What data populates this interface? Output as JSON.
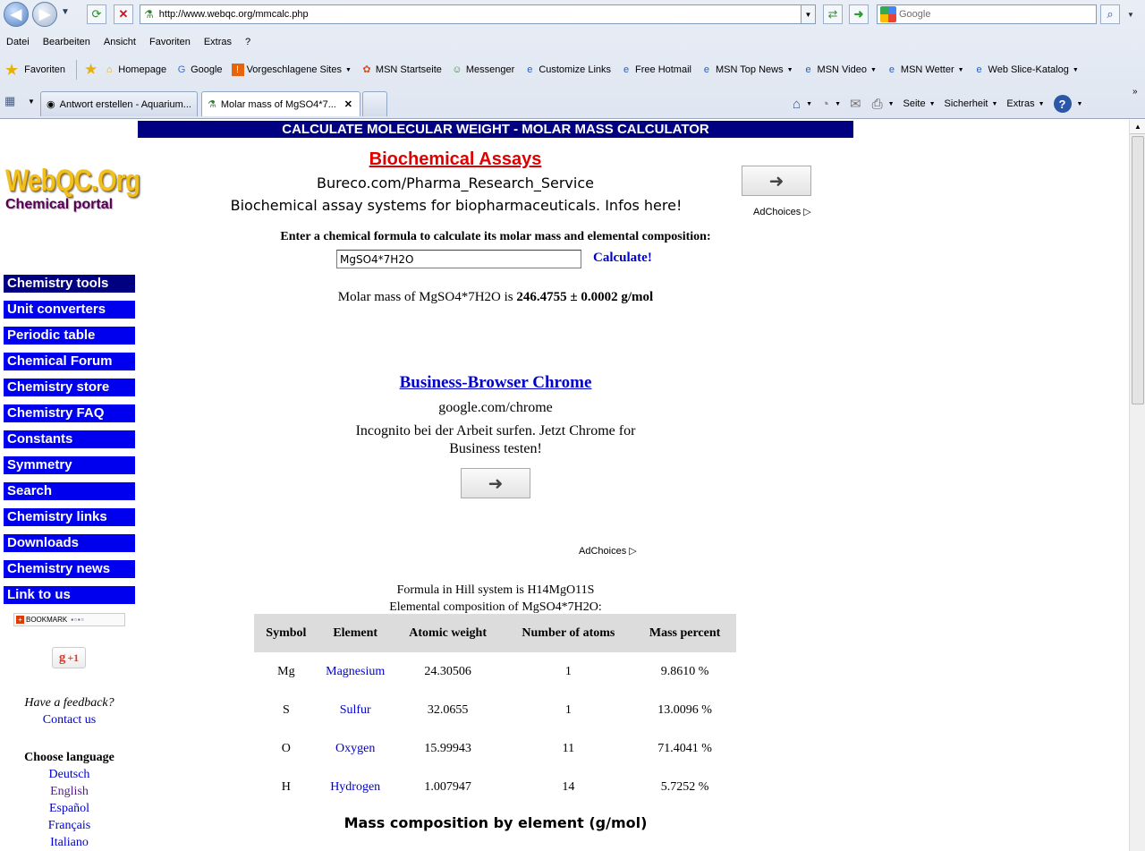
{
  "browser": {
    "address": "http://www.webqc.org/mmcalc.php",
    "search_placeholder": "Google",
    "menu": [
      "Datei",
      "Bearbeiten",
      "Ansicht",
      "Favoriten",
      "Extras",
      "?"
    ],
    "favorites_label": "Favoriten",
    "favorites": [
      {
        "label": "Homepage",
        "icon": "home-icon"
      },
      {
        "label": "Google",
        "icon": "google-icon"
      },
      {
        "label": "Vorgeschlagene Sites",
        "icon": "suggested-sites-icon",
        "dropdown": true
      },
      {
        "label": "MSN Startseite",
        "icon": "msn-icon"
      },
      {
        "label": "Messenger",
        "icon": "messenger-icon"
      },
      {
        "label": "Customize Links",
        "icon": "ie-icon"
      },
      {
        "label": "Free Hotmail",
        "icon": "ie-icon"
      },
      {
        "label": "MSN Top News",
        "icon": "ie-icon",
        "dropdown": true
      },
      {
        "label": "MSN Video",
        "icon": "ie-icon",
        "dropdown": true
      },
      {
        "label": "MSN Wetter",
        "icon": "ie-icon",
        "dropdown": true
      },
      {
        "label": "Web Slice-Katalog",
        "icon": "ie-icon",
        "dropdown": true
      }
    ],
    "tabs": [
      {
        "label": "Antwort erstellen - Aquarium...",
        "active": false
      },
      {
        "label": "Molar mass of MgSO4*7...",
        "active": true
      }
    ],
    "commands": [
      "Seite",
      "Sicherheit",
      "Extras"
    ]
  },
  "page": {
    "banner": "CALCULATE MOLECULAR WEIGHT - MOLAR MASS CALCULATOR",
    "logo": {
      "main": "WebQC.Org",
      "sub": "Chemical portal"
    },
    "nav": [
      "Chemistry tools",
      "Unit converters",
      "Periodic table",
      "Chemical Forum",
      "Chemistry store",
      "Chemistry FAQ",
      "Constants",
      "Symmetry",
      "Search",
      "Chemistry links",
      "Downloads",
      "Chemistry news",
      "Link to us"
    ],
    "bookmark_label": "BOOKMARK",
    "gplus_label": "+1",
    "feedback_question": "Have a feedback?",
    "contact_label": "Contact us",
    "language_title": "Choose language",
    "languages": [
      "Deutsch",
      "English",
      "Español",
      "Français",
      "Italiano"
    ],
    "ad1": {
      "title": "Biochemical Assays",
      "url": "Bureco.com/Pharma_Research_Service",
      "description": "Biochemical assay systems for biopharmaceuticals. Infos here!",
      "adchoices": "AdChoices"
    },
    "prompt": "Enter a chemical formula to calculate its molar mass and elemental composition:",
    "formula_value": "MgSO4*7H2O",
    "calculate_label": "Calculate!",
    "result": {
      "prefix": "Molar mass of MgSO4*7H2O is ",
      "value": "246.4755 ± 0.0002 g/mol"
    },
    "ad2": {
      "title": "Business-Browser Chrome",
      "url": "google.com/chrome",
      "description": "Incognito bei der Arbeit surfen. Jetzt Chrome for Business testen!",
      "adchoices": "AdChoices"
    },
    "hill_formula": "Formula in Hill system is H14MgO11S",
    "composition_title": "Elemental composition of MgSO4*7H2O:",
    "table": {
      "headers": [
        "Symbol",
        "Element",
        "Atomic weight",
        "Number of atoms",
        "Mass percent"
      ],
      "rows": [
        [
          "Mg",
          "Magnesium",
          "24.30506",
          "1",
          "9.8610 %"
        ],
        [
          "S",
          "Sulfur",
          "32.0655",
          "1",
          "13.0096 %"
        ],
        [
          "O",
          "Oxygen",
          "15.99943",
          "11",
          "71.4041 %"
        ],
        [
          "H",
          "Hydrogen",
          "1.007947",
          "14",
          "5.7252 %"
        ]
      ]
    },
    "mass_heading": "Mass composition by element (g/mol)"
  }
}
